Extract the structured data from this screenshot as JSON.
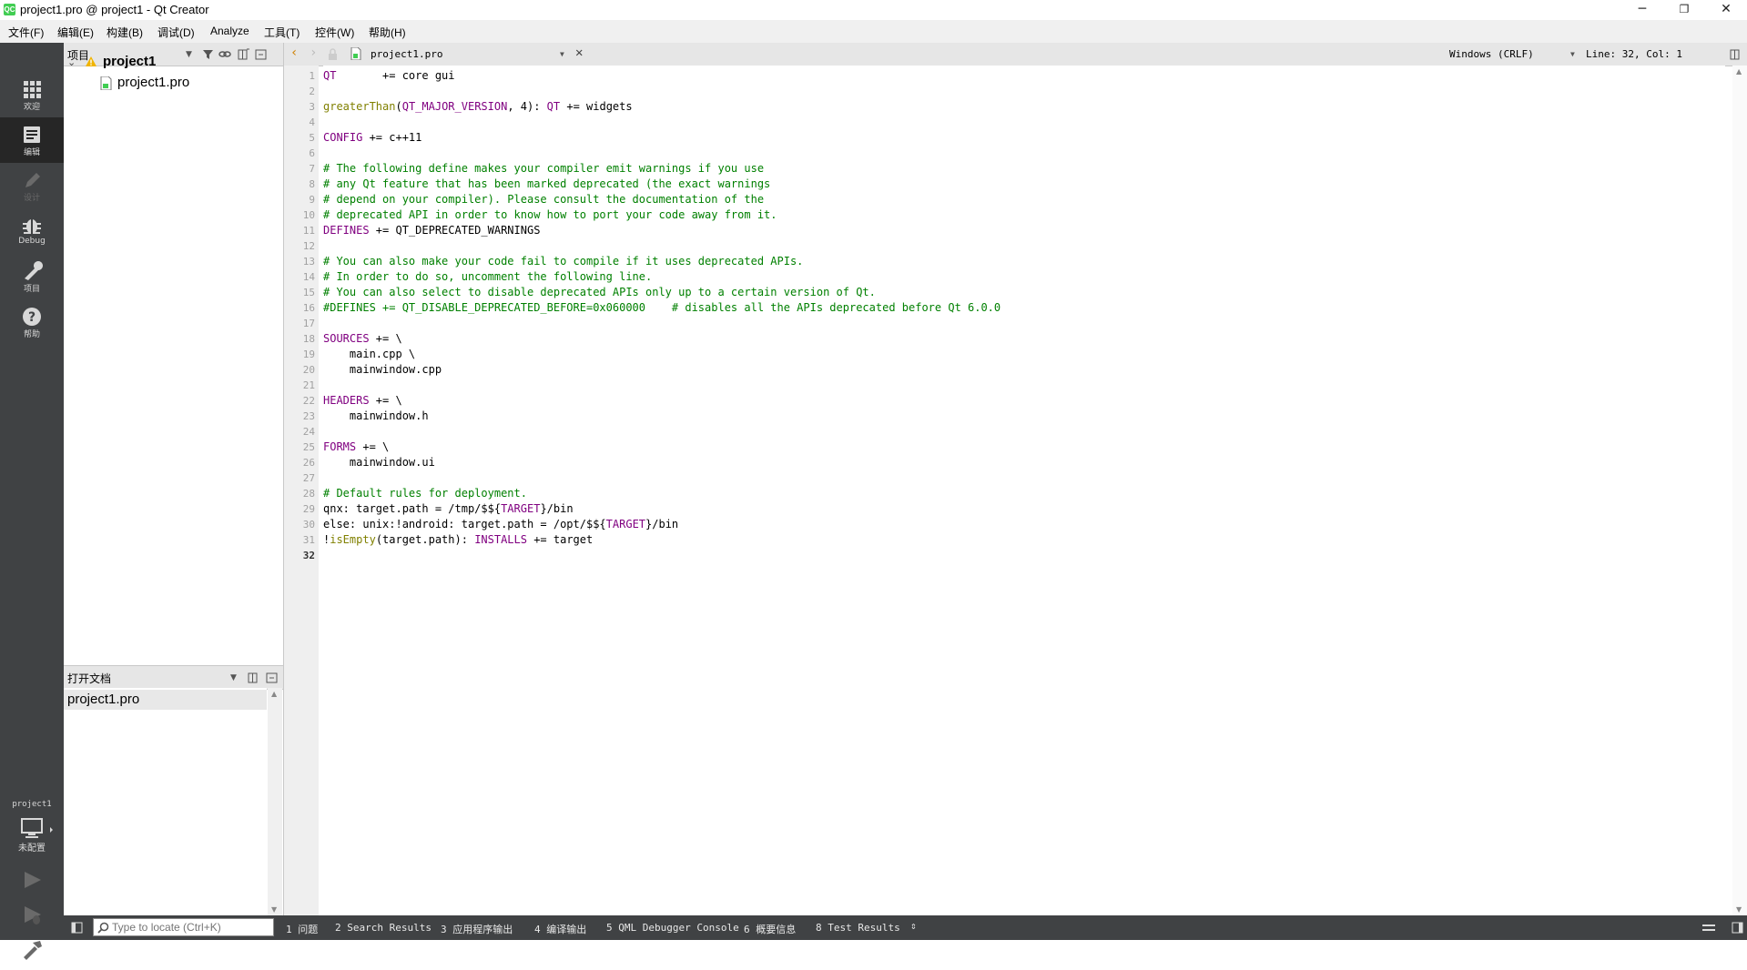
{
  "window": {
    "title": "project1.pro @ project1 - Qt Creator",
    "app_icon_text": "QC",
    "minimize": "─",
    "restore": "❐",
    "close": "✕"
  },
  "menu": [
    "文件(F)",
    "编辑(E)",
    "构建(B)",
    "调试(D)",
    "Analyze",
    "工具(T)",
    "控件(W)",
    "帮助(H)"
  ],
  "modes": {
    "welcome": "欢迎",
    "edit": "编辑",
    "design": "设计",
    "debug": "Debug",
    "projects": "项目",
    "help": "帮助"
  },
  "kit": {
    "project": "project1",
    "status": "未配置"
  },
  "projects_panel": {
    "title": "项目",
    "root": "project1",
    "file": "project1.pro"
  },
  "open_docs": {
    "title": "打开文档",
    "item": "project1.pro"
  },
  "editor": {
    "file": "project1.pro",
    "line_ending": "Windows (CRLF)",
    "position": "Line: 32, Col: 1",
    "current_line": 32,
    "line_numbers": [
      "1",
      "2",
      "3",
      "4",
      "5",
      "6",
      "7",
      "8",
      "9",
      "10",
      "11",
      "12",
      "13",
      "14",
      "15",
      "16",
      "17",
      "18",
      "19",
      "20",
      "21",
      "22",
      "23",
      "24",
      "25",
      "26",
      "27",
      "28",
      "29",
      "30",
      "31",
      "32"
    ],
    "lines": {
      "l1": [
        "QT",
        "       += core gui"
      ],
      "l3": [
        "greaterThan",
        "(",
        "QT_MAJOR_VERSION",
        ", 4): ",
        "QT",
        " += widgets"
      ],
      "l5": [
        "CONFIG",
        " += c++11"
      ],
      "l7": "# The following define makes your compiler emit warnings if you use",
      "l8": "# any Qt feature that has been marked deprecated (the exact warnings",
      "l9": "# depend on your compiler). Please consult the documentation of the",
      "l10": "# deprecated API in order to know how to port your code away from it.",
      "l11": [
        "DEFINES",
        " += QT_DEPRECATED_WARNINGS"
      ],
      "l13": "# You can also make your code fail to compile if it uses deprecated APIs.",
      "l14": "# In order to do so, uncomment the following line.",
      "l15": "# You can also select to disable deprecated APIs only up to a certain version of Qt.",
      "l16": "#DEFINES += QT_DISABLE_DEPRECATED_BEFORE=0x060000    # disables all the APIs deprecated before Qt 6.0.0",
      "l18": [
        "SOURCES",
        " += \\"
      ],
      "l19": "    main.cpp \\",
      "l20": "    mainwindow.cpp",
      "l22": [
        "HEADERS",
        " += \\"
      ],
      "l23": "    mainwindow.h",
      "l25": [
        "FORMS",
        " += \\"
      ],
      "l26": "    mainwindow.ui",
      "l28": "# Default rules for deployment.",
      "l29": [
        "qnx: target.path = /tmp/$${",
        "TARGET",
        "}/bin"
      ],
      "l30": [
        "else: unix:!android: target.path = /opt/$${",
        "TARGET",
        "}/bin"
      ],
      "l31": [
        "!",
        "isEmpty",
        "(target.path): ",
        "INSTALLS",
        " += target"
      ]
    }
  },
  "locator": {
    "placeholder": "Type to locate (Ctrl+K)"
  },
  "output_panes": [
    "1 问题",
    "2 Search Results",
    "3 应用程序输出",
    "4 编译输出",
    "5 QML Debugger Console",
    "6 概要信息",
    "8 Test Results"
  ],
  "colors": {
    "comment": "#008000",
    "keyword": "#800080",
    "function": "#808000",
    "modebar": "#404244"
  }
}
